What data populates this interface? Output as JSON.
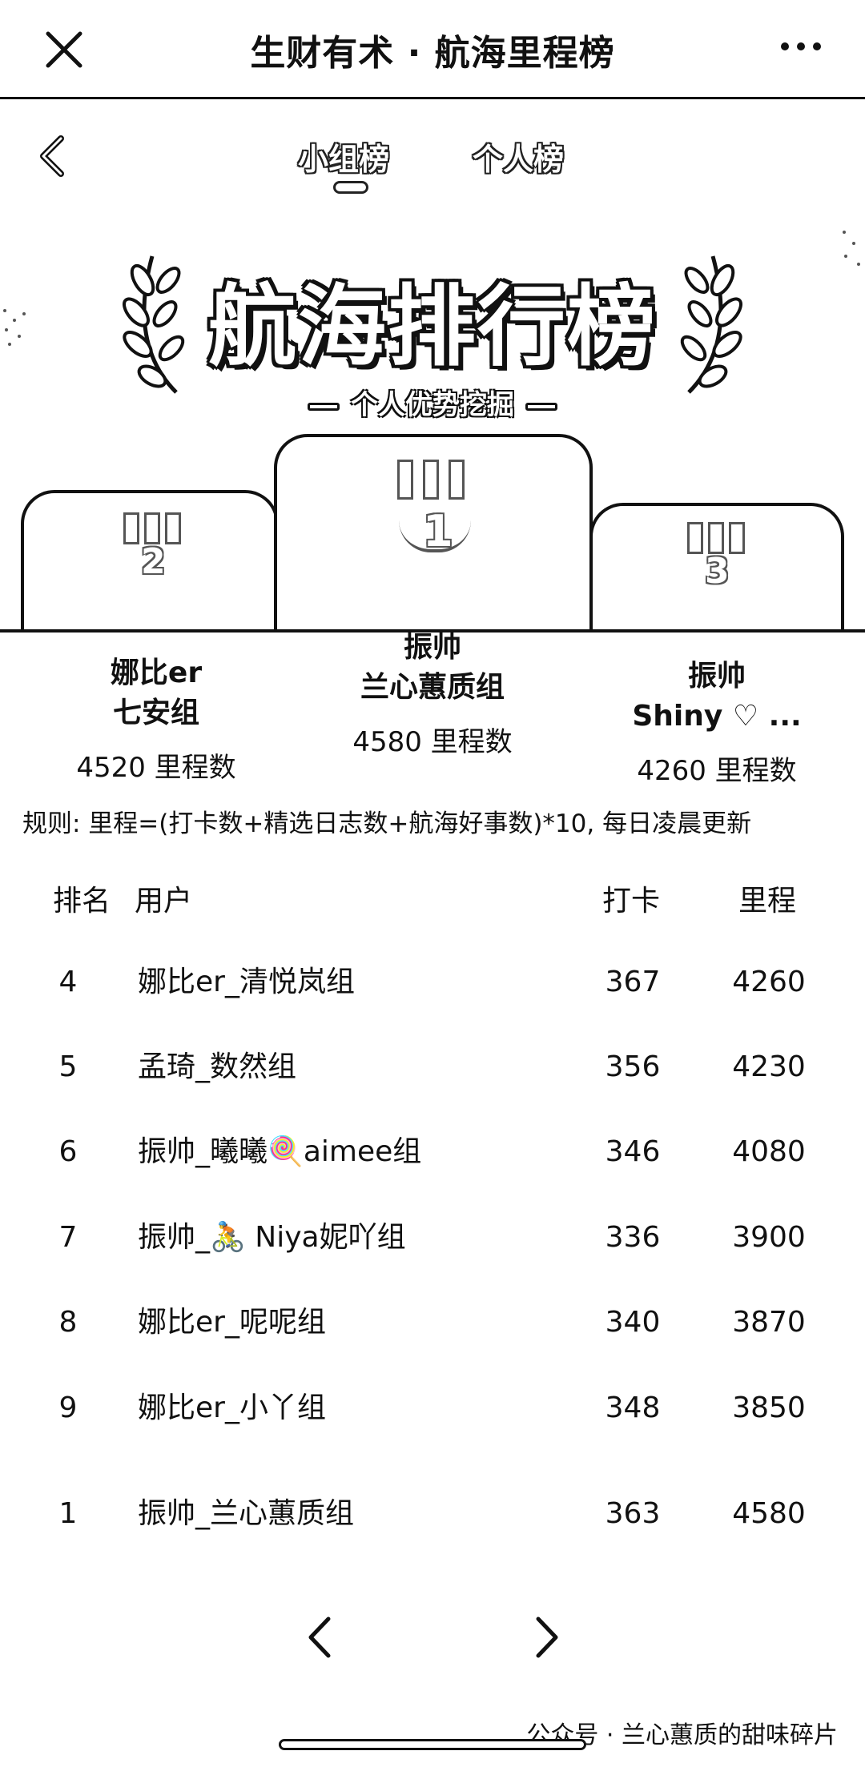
{
  "appbar": {
    "title": "生财有术 · 航海里程榜",
    "close_icon": "close-icon",
    "more_icon": "more-icon"
  },
  "tabs": [
    {
      "label": "小组榜",
      "active": true
    },
    {
      "label": "个人榜",
      "active": false
    }
  ],
  "hero": {
    "title": "航海排行榜",
    "subtitle": "个人优势挖掘"
  },
  "podium": {
    "first": {
      "rank": "1",
      "name_line1": "振帅",
      "name_line2": "兰心蕙质组",
      "score": "4580 里程数"
    },
    "second": {
      "rank": "2",
      "name_line1": "娜比er",
      "name_line2": "七安组",
      "score": "4520 里程数"
    },
    "third": {
      "rank": "3",
      "name_line1": "振帅",
      "name_line2": "Shiny ♡ ...",
      "score": "4260 里程数"
    }
  },
  "rule": "规则: 里程=(打卡数+精选日志数+航海好事数)*10, 每日凌晨更新",
  "table": {
    "headers": {
      "rank": "排名",
      "user": "用户",
      "punch": "打卡",
      "miles": "里程"
    },
    "rows": [
      {
        "rank": "4",
        "user": "娜比er_清悦岚组",
        "punch": "367",
        "miles": "4260"
      },
      {
        "rank": "5",
        "user": "孟琦_数然组",
        "punch": "356",
        "miles": "4230"
      },
      {
        "rank": "6",
        "user": "振帅_曦曦🍭aimee组",
        "punch": "346",
        "miles": "4080"
      },
      {
        "rank": "7",
        "user": "振帅_🚴 Niya妮吖组",
        "punch": "336",
        "miles": "3900"
      },
      {
        "rank": "8",
        "user": "娜比er_呢呢组",
        "punch": "340",
        "miles": "3870"
      },
      {
        "rank": "9",
        "user": "娜比er_小丫组",
        "punch": "348",
        "miles": "3850"
      }
    ],
    "self_row": {
      "rank": "1",
      "user": "振帅_兰心蕙质组",
      "punch": "363",
      "miles": "4580"
    }
  },
  "pager": {
    "prev_icon": "chevron-left-icon",
    "next_icon": "chevron-right-icon"
  },
  "watermark": "公众号 · 兰心蕙质的甜味碎片"
}
